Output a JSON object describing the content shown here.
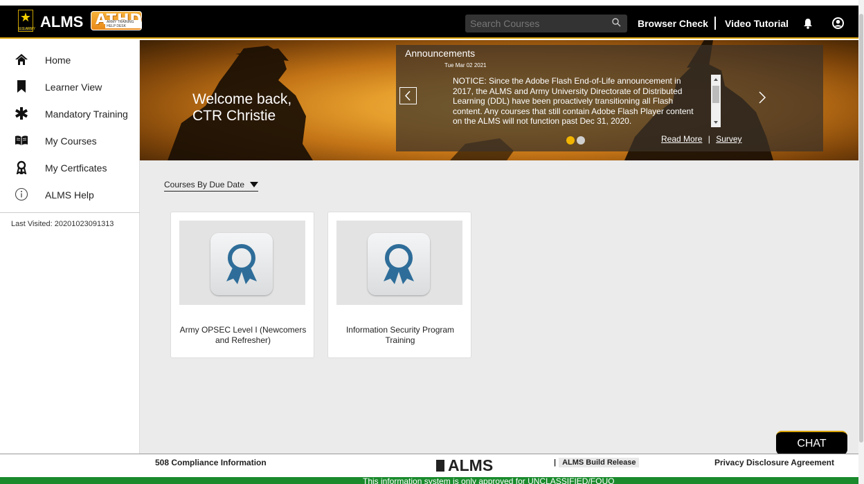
{
  "header": {
    "logo_army_text": "U.S.ARMY",
    "app_title": "ALMS",
    "athd_logo_text": "ATHD",
    "athd_logo_subtitle": "ARMY TRAINING HELP DESK",
    "search_placeholder": "Search Courses",
    "browser_check": "Browser Check",
    "video_tutorial": "Video Tutorial"
  },
  "sidebar": {
    "items": [
      {
        "label": "Home",
        "icon": "home-icon"
      },
      {
        "label": "Learner View",
        "icon": "bookmark-icon"
      },
      {
        "label": "Mandatory Training",
        "icon": "asterisk-icon"
      },
      {
        "label": "My Courses",
        "icon": "open-book-icon"
      },
      {
        "label": "My Certficates",
        "icon": "ribbon-icon"
      },
      {
        "label": "ALMS Help",
        "icon": "info-icon"
      }
    ],
    "last_visited": "Last Visited: 20201023091313"
  },
  "hero": {
    "welcome_line1": "Welcome back,",
    "welcome_line2": "CTR Christie",
    "announcements_title": "Announcements",
    "announcement_date": "Tue Mar 02 2021",
    "announcement_text": "NOTICE: Since the Adobe Flash End-of-Life announcement in 2017, the ALMS and Army University Directorate of Distributed Learning (DDL) have been proactively transitioning all Flash content. Any courses that still contain Adobe Flash Player content on the ALMS will not function past Dec 31, 2020.",
    "read_more": "Read More",
    "link_separator": "|",
    "survey": "Survey"
  },
  "main": {
    "sort_label": "Courses By Due Date",
    "courses": [
      {
        "title": "Army OPSEC Level I (Newcomers and Refresher)"
      },
      {
        "title": "Information Security Program Training"
      }
    ]
  },
  "chat_label": "CHAT",
  "footer": {
    "compliance": "508 Compliance Information",
    "logo_text": "ALMS",
    "build_release_prefix": "|",
    "build_release": "ALMS Build Release",
    "privacy": "Privacy Disclosure Agreement",
    "classification": "This information system is only approved for UNCLASSIFIED/FOUO"
  },
  "colors": {
    "gold_accent": "#d8a300",
    "classification_green": "#1a8a2c",
    "ribbon_blue": "#2e6d99"
  }
}
